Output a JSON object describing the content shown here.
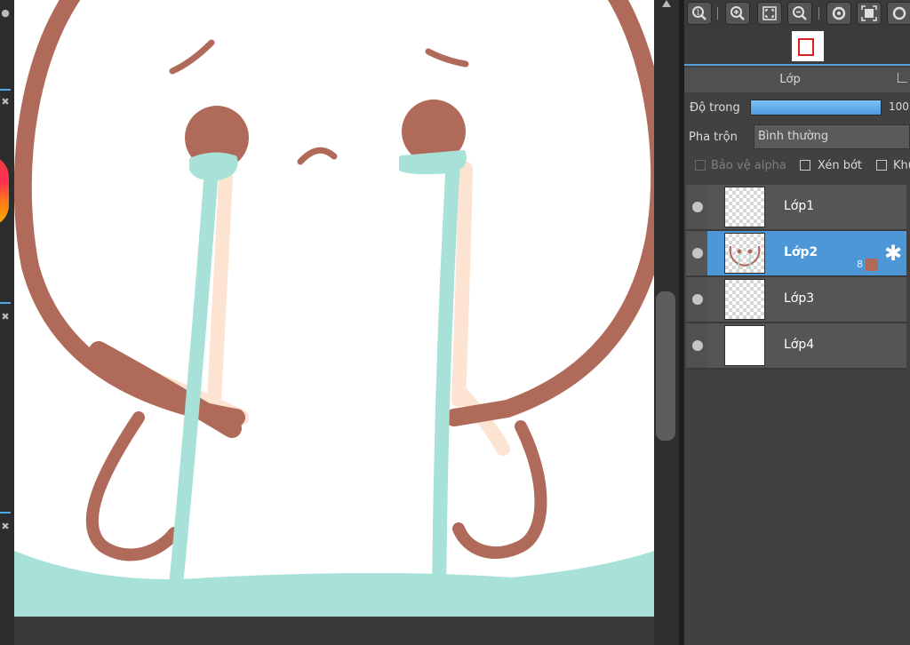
{
  "canvas": {
    "colors": {
      "outline": "#b06a5a",
      "tears": "#a7e1d8",
      "blush": "#fde3d2",
      "ground": "#a7e1d8",
      "paper": "#ffffff"
    }
  },
  "toolbar": {
    "buttons": [
      "zoom-actual-icon",
      "zoom-in-icon",
      "fit-screen-icon",
      "zoom-out-icon",
      "rotate-icon",
      "fullscreen-icon",
      "rotate-reset-icon"
    ]
  },
  "layer_panel": {
    "title": "Lớp",
    "opacity_label": "Độ trong",
    "opacity_value": "100",
    "opacity": 1.0,
    "blend_label": "Pha trộn",
    "blend_value": "Bình thường",
    "checkboxes": [
      {
        "label": "Bảo vệ alpha",
        "checked": false,
        "enabled": false
      },
      {
        "label": "Xén bớt",
        "checked": false,
        "enabled": true
      },
      {
        "label": "Khu",
        "checked": false,
        "enabled": true
      }
    ],
    "layers": [
      {
        "name": "Lớp1",
        "selected": false
      },
      {
        "name": "Lớp2",
        "selected": true,
        "clip_count": "8",
        "clip_color": "#b06a5a"
      },
      {
        "name": "Lớp3",
        "selected": false
      },
      {
        "name": "Lớp4",
        "selected": false
      }
    ]
  },
  "accent_color": "#4d97d7"
}
